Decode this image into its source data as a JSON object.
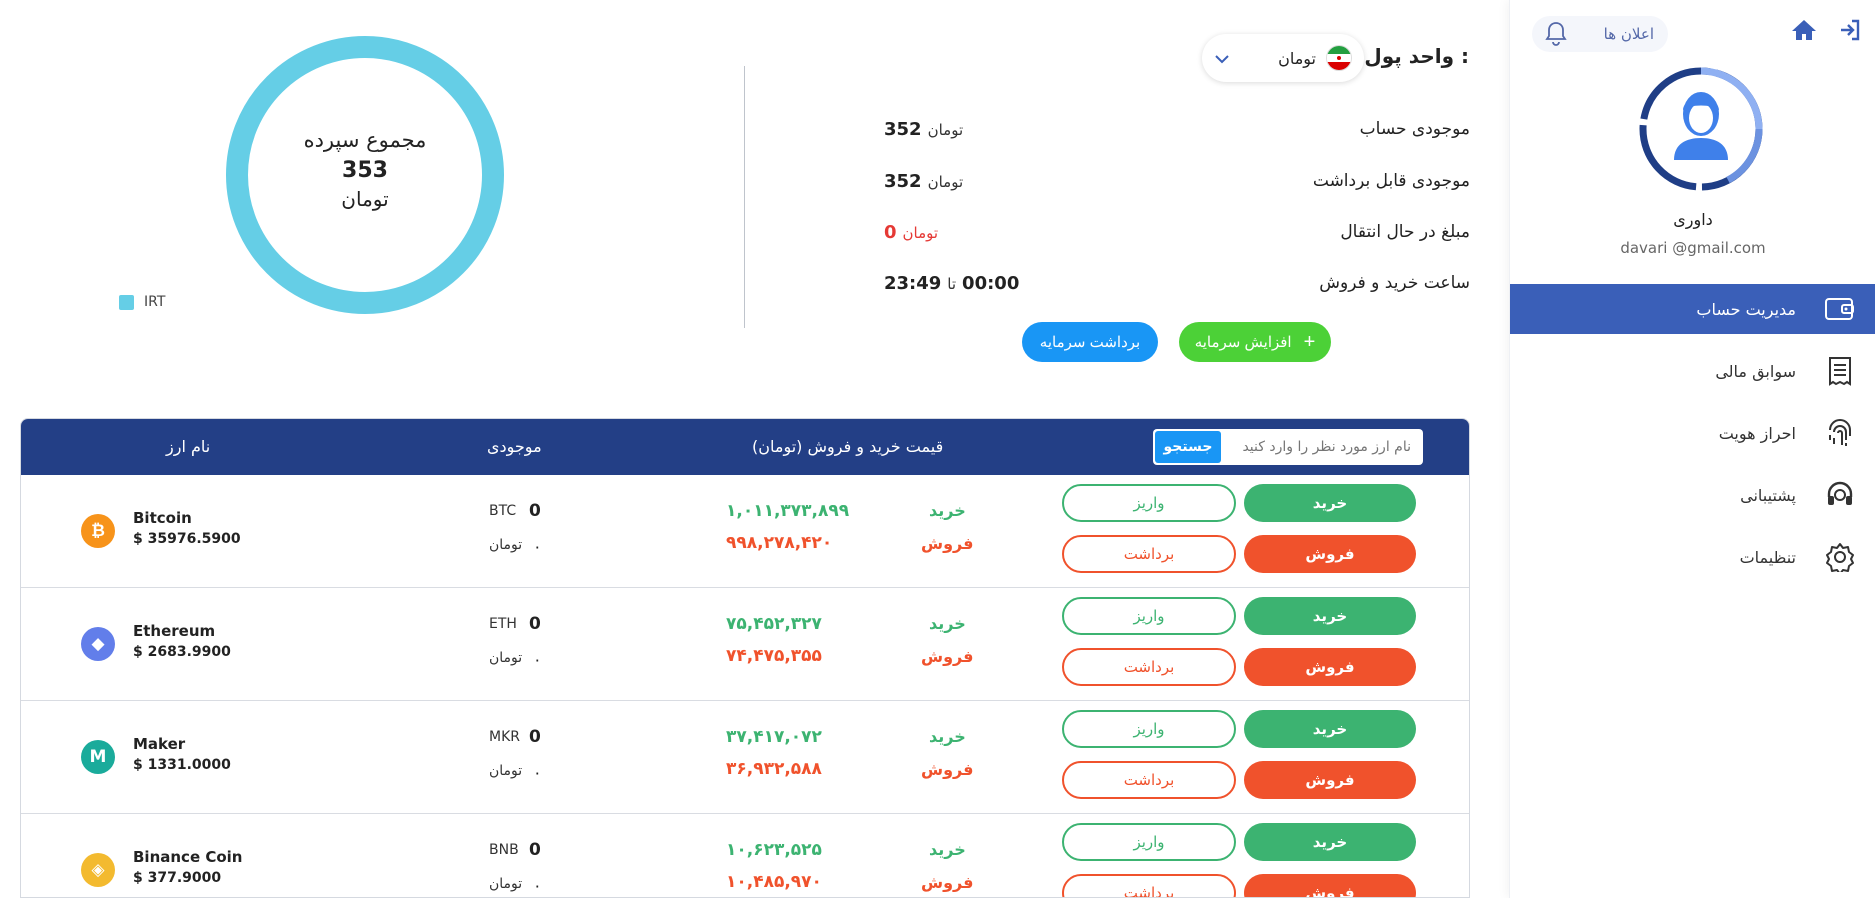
{
  "sidebar": {
    "notifications_label": "اعلان ها",
    "user_name": "داوری",
    "user_email": "davari  @gmail.com",
    "items": [
      {
        "label": "مدیریت حساب",
        "icon": "wallet-icon",
        "active": true
      },
      {
        "label": "سوابق مالی",
        "icon": "receipt-icon",
        "active": false
      },
      {
        "label": "احراز هویت",
        "icon": "fingerprint-icon",
        "active": false
      },
      {
        "label": "پشتیبانی",
        "icon": "headset-icon",
        "active": false
      },
      {
        "label": "تنظیمات",
        "icon": "gear-icon",
        "active": false
      }
    ]
  },
  "summary": {
    "currency_label": "واحد پول :",
    "currency_value": "تومان",
    "rows": [
      {
        "key": "موجودی حساب",
        "value": "352",
        "unit": "تومان"
      },
      {
        "key": "موجودی قابل برداشت",
        "value": "352",
        "unit": "تومان"
      },
      {
        "key": "مبلغ در حال انتقال",
        "value": "0",
        "unit": "تومان"
      },
      {
        "key": "ساعت خرید و فروش",
        "from": "00:00",
        "sep": "تا",
        "to": "23:49"
      }
    ],
    "increase_label": "افزایش سرمایه",
    "withdraw_label": "برداشت سرمایه"
  },
  "donut": {
    "title": "مجموع سپرده",
    "value": "353",
    "unit": "تومان",
    "legend": "IRT",
    "color": "#65cee6"
  },
  "table": {
    "headers": {
      "name": "نام ارز",
      "balance": "موجودی",
      "price": "قیمت خرید و فروش (تومان)",
      "search_button": "جستجو",
      "search_placeholder": "نام ارز مورد نظر را وارد کنید"
    },
    "labels": {
      "buy": "خرید",
      "sell": "فروش",
      "deposit": "واریز",
      "withdraw": "برداشت",
      "toman": "تومان"
    },
    "rows": [
      {
        "name": "Bitcoin",
        "price": "$ 35976.5900",
        "symbol": "BTC",
        "balance": "0",
        "toman_balance": "۰",
        "buy_price": "۱,۰۱۱,۳۷۳,۸۹۹",
        "sell_price": "۹۹۸,۲۷۸,۴۲۰",
        "color": "#f7931a",
        "glyph": "₿"
      },
      {
        "name": "Ethereum",
        "price": "$ 2683.9900",
        "symbol": "ETH",
        "balance": "0",
        "toman_balance": "۰",
        "buy_price": "۷۵,۴۵۲,۳۲۷",
        "sell_price": "۷۴,۴۷۵,۳۵۵",
        "color": "#627eea",
        "glyph": "◆"
      },
      {
        "name": "Maker",
        "price": "$ 1331.0000",
        "symbol": "MKR",
        "balance": "0",
        "toman_balance": "۰",
        "buy_price": "۳۷,۴۱۷,۰۷۲",
        "sell_price": "۳۶,۹۳۲,۵۸۸",
        "color": "#1aab9b",
        "glyph": "M"
      },
      {
        "name": "Binance Coin",
        "price": "$ 377.9000",
        "symbol": "BNB",
        "balance": "0",
        "toman_balance": "۰",
        "buy_price": "۱۰,۶۲۳,۵۲۵",
        "sell_price": "۱۰,۴۸۵,۹۷۰",
        "color": "#f3ba2f",
        "glyph": "◈"
      }
    ]
  }
}
